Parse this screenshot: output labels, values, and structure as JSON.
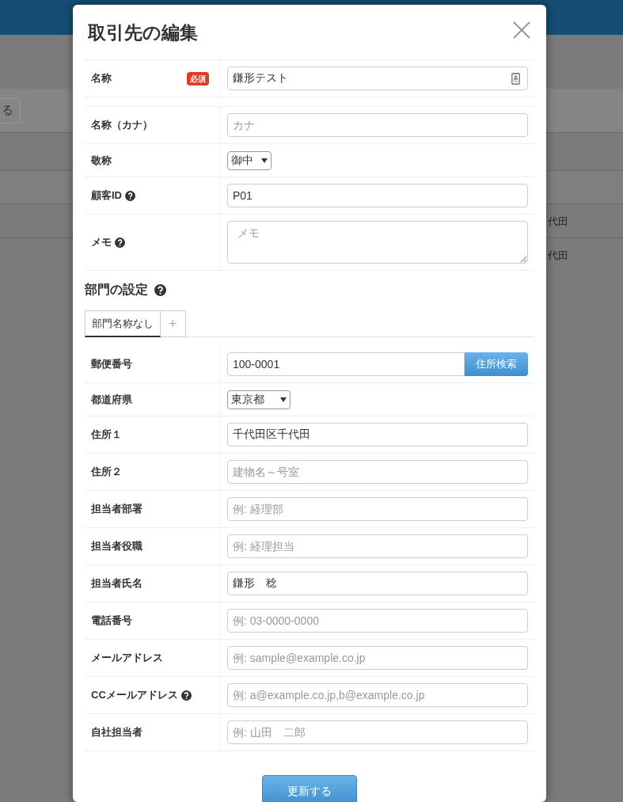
{
  "background": {
    "button_fragment": "る",
    "cells": [
      "代田",
      "代田"
    ]
  },
  "dialog": {
    "title": "取引先の編集",
    "top_fields": [
      {
        "kind": "text",
        "label": "名称",
        "required_badge": "必須",
        "help": false,
        "value": "鎌形テスト",
        "autofill_icon": true
      },
      {
        "kind": "text",
        "label": "名称（カナ）",
        "help": false,
        "placeholder": "カナ"
      },
      {
        "kind": "select",
        "label": "敬称",
        "help": false,
        "value": "御中"
      },
      {
        "kind": "text",
        "label": "顧客ID",
        "help": true,
        "value": "P01"
      },
      {
        "kind": "textarea",
        "label": "メモ",
        "help": true,
        "placeholder": "メモ"
      }
    ],
    "section": {
      "title": "部門の設定",
      "help": true
    },
    "tabs": [
      {
        "label": "部門名称なし",
        "selected": true
      },
      {
        "label": "+",
        "selected": false
      }
    ],
    "dept_fields": [
      {
        "kind": "zip",
        "label": "郵便番号",
        "help": false,
        "value": "100-0001",
        "button": "住所検索"
      },
      {
        "kind": "select",
        "label": "都道府県",
        "help": false,
        "value": "東京都"
      },
      {
        "kind": "text",
        "label": "住所１",
        "help": false,
        "value": "千代田区千代田"
      },
      {
        "kind": "text",
        "label": "住所２",
        "help": false,
        "placeholder": "建物名～号室"
      },
      {
        "kind": "text",
        "label": "担当者部署",
        "help": false,
        "placeholder": "例: 経理部"
      },
      {
        "kind": "text",
        "label": "担当者役職",
        "help": false,
        "placeholder": "例: 経理担当"
      },
      {
        "kind": "text",
        "label": "担当者氏名",
        "help": false,
        "value": "鎌形　稔"
      },
      {
        "kind": "text",
        "label": "電話番号",
        "help": false,
        "placeholder": "例: 03-0000-0000"
      },
      {
        "kind": "text",
        "label": "メールアドレス",
        "help": false,
        "placeholder": "例: sample@example.co.jp"
      },
      {
        "kind": "text",
        "label": "CCメールアドレス",
        "help": true,
        "placeholder": "例: a@example.co.jp,b@example.co.jp"
      },
      {
        "kind": "text",
        "label": "自社担当者",
        "help": false,
        "placeholder": "例: 山田　二郎"
      }
    ],
    "submit": "更新する"
  }
}
